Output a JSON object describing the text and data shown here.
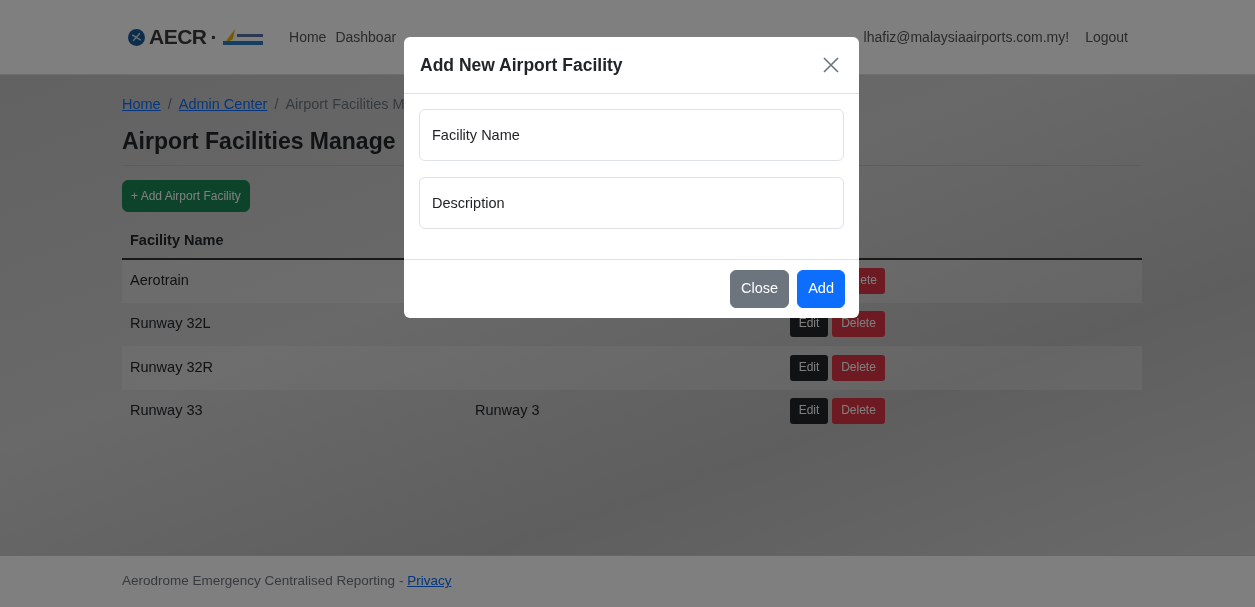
{
  "navbar": {
    "brand": {
      "name": "AECR",
      "separator": "·"
    },
    "links": [
      "Home",
      "Dashboar"
    ],
    "user": "lhafiz@malaysiaairports.com.my!",
    "logout": "Logout"
  },
  "breadcrumb": {
    "separator": "/",
    "items": [
      {
        "label": "Home",
        "link": true
      },
      {
        "label": "Admin Center",
        "link": true
      },
      {
        "label": "Airport Facilities M",
        "link": false
      }
    ]
  },
  "page_title": "Airport Facilities Manage",
  "add_button": "+ Add Airport Facility",
  "table": {
    "columns": [
      "Facility Name"
    ],
    "rows": [
      {
        "name": "Aerotrain",
        "actions": [
          {
            "kind": "delete",
            "label": "ete"
          }
        ]
      },
      {
        "name": "Runway 32L",
        "actions": [
          {
            "kind": "edit",
            "label": "Edit"
          },
          {
            "kind": "delete",
            "label": "Delete"
          }
        ]
      },
      {
        "name": "Runway 32R",
        "actions": [
          {
            "kind": "edit",
            "label": "Edit"
          },
          {
            "kind": "delete",
            "label": "Delete"
          }
        ]
      },
      {
        "name": "Runway 33",
        "description": "Runway 3",
        "actions": [
          {
            "kind": "edit",
            "label": "Edit"
          },
          {
            "kind": "delete",
            "label": "Delete"
          }
        ]
      }
    ]
  },
  "modal": {
    "title": "Add New Airport Facility",
    "fields": [
      {
        "placeholder": "Facility Name"
      },
      {
        "placeholder": "Description"
      }
    ],
    "buttons": [
      {
        "kind": "secondary",
        "label": "Close"
      },
      {
        "kind": "primary",
        "label": "Add"
      }
    ]
  },
  "footer": {
    "text": "Aerodrome Emergency Centralised Reporting - ",
    "link": "Privacy"
  }
}
